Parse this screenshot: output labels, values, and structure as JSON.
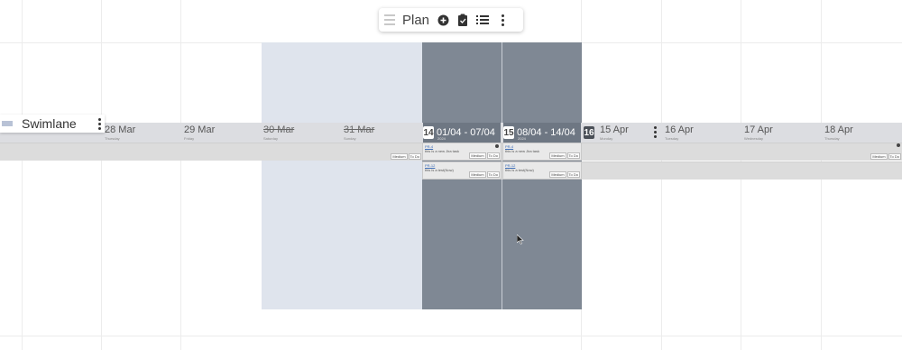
{
  "toolbar": {
    "title": "Plan",
    "icons": [
      "drag-handle-icon",
      "add-circle-icon",
      "clipboard-icon",
      "list-icon",
      "more-vertical-icon"
    ]
  },
  "swimlane": {
    "label": "Swimlane"
  },
  "days": [
    {
      "date": "28 Mar",
      "weekday": "Thursday",
      "strike": false
    },
    {
      "date": "29 Mar",
      "weekday": "Friday",
      "strike": false
    },
    {
      "date": "30 Mar",
      "weekday": "Saturday",
      "strike": true
    },
    {
      "date": "31 Mar",
      "weekday": "Sunday",
      "strike": true
    },
    {
      "date": "15 Apr",
      "weekday": "Monday",
      "strike": false
    },
    {
      "date": "16 Apr",
      "weekday": "Tuesday",
      "strike": false
    },
    {
      "date": "17 Apr",
      "weekday": "Wednesday",
      "strike": false
    },
    {
      "date": "18 Apr",
      "weekday": "Thursday",
      "strike": false
    }
  ],
  "sprints": [
    {
      "number": "14",
      "range": "01/04 - 07/04",
      "sub": "2024"
    },
    {
      "number": "15",
      "range": "08/04 - 14/04",
      "sub": "2024"
    },
    {
      "number": "16",
      "range": ""
    }
  ],
  "tasks": [
    {
      "key": "PR-4",
      "summary": "this is a new Jira task",
      "priority": "Medium",
      "status": "To Do"
    },
    {
      "key": "PR-4",
      "summary": "this is a new Jira task",
      "priority": "Medium",
      "status": "To Do"
    },
    {
      "key": "PR-12",
      "summary": "this is a test(Now)",
      "priority": "Medium",
      "status": "To Do"
    },
    {
      "key": "PR-12",
      "summary": "this is a test(Now)",
      "priority": "Medium",
      "status": "To Do"
    },
    {
      "key": "",
      "summary": "",
      "priority": "Medium",
      "status": "To Do"
    },
    {
      "key": "",
      "summary": "",
      "priority": "Medium",
      "status": "To Do"
    }
  ]
}
